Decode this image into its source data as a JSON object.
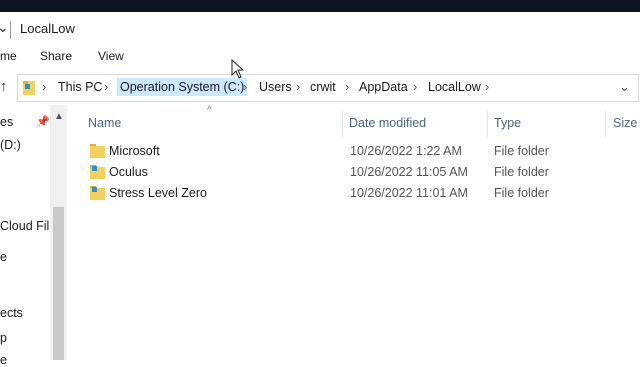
{
  "window": {
    "title": "LocalLow"
  },
  "ribbon": {
    "tabs": [
      "me",
      "Share",
      "View"
    ]
  },
  "address": {
    "crumbs": [
      "This PC",
      "Operation System (C:)",
      "Users",
      "crwit",
      "AppData",
      "LocalLow"
    ],
    "active_crumb": "Operation System (C:)",
    "separator": "›",
    "dropdown_icon": "chevron-down-icon"
  },
  "nav": {
    "items": [
      "es",
      "(D:)",
      "Cloud Fil",
      "e",
      "ects",
      "p",
      "e"
    ],
    "pin_icon": "pin-icon"
  },
  "columns": {
    "name": "Name",
    "date": "Date modified",
    "type": "Type",
    "size": "Size"
  },
  "files": [
    {
      "name": "Microsoft",
      "date": "10/26/2022 1:22 AM",
      "type": "File folder"
    },
    {
      "name": "Oculus",
      "date": "10/26/2022 11:05 AM",
      "type": "File folder"
    },
    {
      "name": "Stress Level Zero",
      "date": "10/26/2022 11:01 AM",
      "type": "File folder"
    }
  ],
  "colors": {
    "folder": "#f3d15a",
    "folder_shadow": "#dcb43c",
    "header_text": "#4a6584",
    "selected_crumb": "#cce8ff"
  }
}
